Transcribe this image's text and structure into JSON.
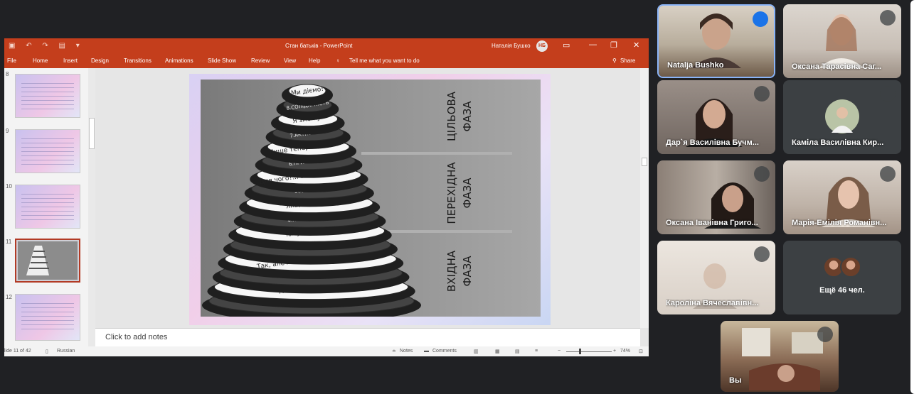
{
  "app": {
    "title_bar": {
      "document_title": "Стан батьків - PowerPoint",
      "user_name": "Наталія Бушко",
      "user_initials": "НБ"
    },
    "ribbon_tabs": [
      "File",
      "Home",
      "Insert",
      "Design",
      "Transitions",
      "Animations",
      "Slide Show",
      "Review",
      "View",
      "Help"
    ],
    "tell_me": "Tell me what you want to do",
    "share_label": "Share",
    "thumbnail_numbers": [
      "8",
      "9",
      "10",
      "11",
      "12"
    ],
    "notes_placeholder": "Click to add notes",
    "status": {
      "slide_counter": "lide 11 of 42",
      "language": "Russian",
      "notes_label": "Notes",
      "comments_label": "Comments",
      "zoom": "74%"
    }
  },
  "slide": {
    "rings": [
      "Ми діємо!",
      "8.СОЛІДАРНІСТЬ",
      "Я зможу!",
      "7.АКТИВНІСТЬ",
      "Лише тепер я визнаю…",
      "6.ПРИМИРЕННЯ",
      "Для чого?... все не має змісту",
      "5.ДЕПРЕСІЯ",
      "Якщо так,то…",
      "4.ПОШУК(ТОРГИ)",
      "Чому власне я ?",
      "3.АГРЕСІЯ",
      "Так, але ж цього не може бути?",
      "2.УСВІДОМЛЕННЯ",
      "А що ж трапилось?",
      "1.НЕВИЗНАЧЕНІСТЬ"
    ],
    "phases": [
      {
        "line1": "ЦІЛЬОВА",
        "line2": "ФАЗА"
      },
      {
        "line1": "ПЕРЕХІДНА",
        "line2": "ФАЗА"
      },
      {
        "line1": "ВХІДНА",
        "line2": "ФАЗА"
      }
    ]
  },
  "participants": [
    {
      "name": "Natalja Bushko",
      "speaking": true
    },
    {
      "name": "Оксана Тарасівна Саг...",
      "speaking": false
    },
    {
      "name": "Дар`я Василівна Бучм...",
      "speaking": false
    },
    {
      "name": "Каміла Василівна Кир...",
      "speaking": false
    },
    {
      "name": "Оксана Іванівна Григо...",
      "speaking": false
    },
    {
      "name": "Марія-Емілія Романівн...",
      "speaking": false
    },
    {
      "name": "Кароліна Вячеславівн...",
      "speaking": false
    },
    {
      "name": "Вы",
      "speaking": false
    }
  ],
  "more_participants": "Ещё 46 чел.",
  "colors": {
    "ppt_accent": "#c43e1c",
    "meet_background": "#202124",
    "tile": "#3c4043",
    "speaking": "#1a73e8"
  }
}
